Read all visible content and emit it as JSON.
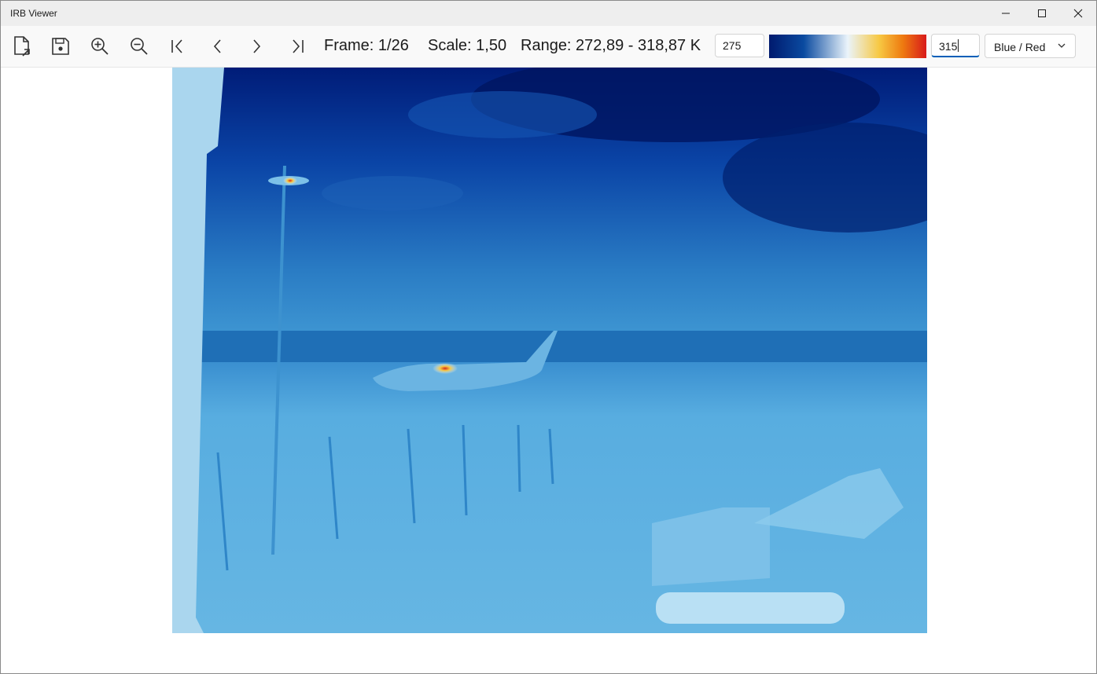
{
  "window": {
    "title": "IRB Viewer",
    "controls": [
      "minimize",
      "maximize",
      "close"
    ]
  },
  "toolbar": {
    "buttons": [
      {
        "name": "open-file",
        "icon": "open-file-icon"
      },
      {
        "name": "save",
        "icon": "save-icon"
      },
      {
        "name": "zoom-in",
        "icon": "zoom-in-icon"
      },
      {
        "name": "zoom-out",
        "icon": "zoom-out-icon"
      },
      {
        "name": "first-frame",
        "icon": "first-frame-icon"
      },
      {
        "name": "previous-frame",
        "icon": "chevron-left-icon"
      },
      {
        "name": "next-frame",
        "icon": "chevron-right-icon"
      },
      {
        "name": "last-frame",
        "icon": "last-frame-icon"
      }
    ],
    "frame_text": "Frame: 1/26",
    "scale_text": "Scale: 1,50",
    "range_text": "Range: 272,89 - 318,87 K",
    "min_value": "275",
    "max_value": "315",
    "palette": {
      "selected": "Blue / Red",
      "colors": [
        "#001a6e",
        "#0a4aa0",
        "#eaf4fb",
        "#f7c843",
        "#ee7a10",
        "#d81a1a"
      ]
    }
  },
  "image": {
    "description_icon": "thermal-image",
    "colors": {
      "sky": "#0a3a9e",
      "ground": "#4fa8da",
      "hot": "#ffe14a"
    }
  }
}
